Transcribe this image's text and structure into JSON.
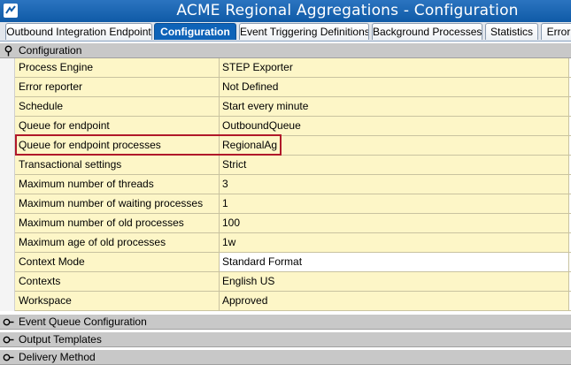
{
  "window": {
    "title": "ACME Regional Aggregations - Configuration"
  },
  "tabs": [
    {
      "label": "Outbound Integration Endpoint",
      "active": false
    },
    {
      "label": "Configuration",
      "active": true
    },
    {
      "label": "Event Triggering Definitions",
      "active": false
    },
    {
      "label": "Background Processes",
      "active": false
    },
    {
      "label": "Statistics",
      "active": false
    },
    {
      "label": "Error",
      "active": false
    }
  ],
  "sections": {
    "configuration": "Configuration",
    "event_queue": "Event Queue Configuration",
    "output_templates": "Output Templates",
    "delivery_method": "Delivery Method"
  },
  "rows": [
    {
      "key": "Process Engine",
      "value": "STEP Exporter"
    },
    {
      "key": "Error reporter",
      "value": "Not Defined"
    },
    {
      "key": "Schedule",
      "value": "Start every minute"
    },
    {
      "key": "Queue for endpoint",
      "value": "OutboundQueue"
    },
    {
      "key": "Queue for endpoint processes",
      "value": "RegionalAg"
    },
    {
      "key": "Transactional settings",
      "value": "Strict"
    },
    {
      "key": "Maximum number of threads",
      "value": "3"
    },
    {
      "key": "Maximum number of waiting processes",
      "value": "1"
    },
    {
      "key": "Maximum number of old processes",
      "value": "100"
    },
    {
      "key": "Maximum age of old processes",
      "value": "1w"
    },
    {
      "key": "Context Mode",
      "value": "Standard Format"
    },
    {
      "key": "Contexts",
      "value": "English US"
    },
    {
      "key": "Workspace",
      "value": "Approved"
    }
  ],
  "colors": {
    "titlebar": "#0f5aa7",
    "active_tab": "#0e63b8",
    "row_bg": "#fdf6c7",
    "highlight_border": "#b0182a",
    "section_header": "#c8c8c8"
  }
}
